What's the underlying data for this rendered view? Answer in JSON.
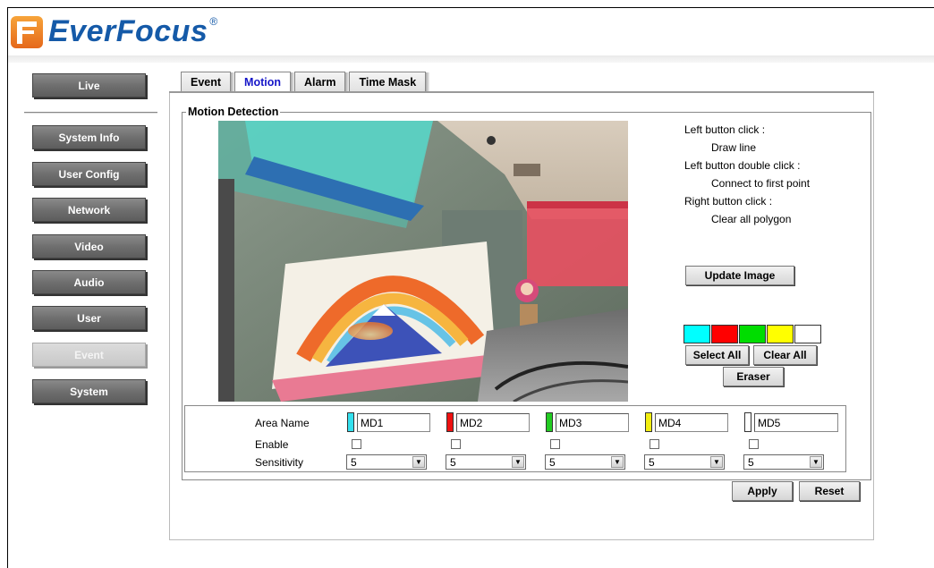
{
  "brand": {
    "name": "EverFocus",
    "reg": "®"
  },
  "sidebar": {
    "live": "Live",
    "items": [
      "System Info",
      "User Config",
      "Network",
      "Video",
      "Audio",
      "User",
      "Event",
      "System"
    ],
    "active": "Event"
  },
  "tabs": [
    {
      "label": "Event",
      "active": false
    },
    {
      "label": "Motion",
      "active": true
    },
    {
      "label": "Alarm",
      "active": false
    },
    {
      "label": "Time Mask",
      "active": false
    }
  ],
  "motion": {
    "legend": "Motion Detection",
    "instructions": {
      "left_click": "Left button click :",
      "left_click_desc": "Draw line",
      "double_click": "Left button double click :",
      "double_click_desc": "Connect to first point",
      "right_click": "Right button click :",
      "right_click_desc": "Clear all polygon"
    },
    "update_image": "Update Image",
    "swatches": [
      "#00ffff",
      "#ff0000",
      "#00dd00",
      "#ffff00",
      "#ffffff"
    ],
    "select_all": "Select All",
    "clear_all": "Clear All",
    "eraser": "Eraser"
  },
  "areas": {
    "labels": {
      "name": "Area Name",
      "enable": "Enable",
      "sensitivity": "Sensitivity"
    },
    "items": [
      {
        "name": "MD1",
        "color": "#33e0ee",
        "enabled": false,
        "sensitivity": "5"
      },
      {
        "name": "MD2",
        "color": "#ee1111",
        "enabled": false,
        "sensitivity": "5"
      },
      {
        "name": "MD3",
        "color": "#22cc22",
        "enabled": false,
        "sensitivity": "5"
      },
      {
        "name": "MD4",
        "color": "#f2ee11",
        "enabled": false,
        "sensitivity": "5"
      },
      {
        "name": "MD5",
        "color": "#ffffff",
        "enabled": false,
        "sensitivity": "5"
      }
    ]
  },
  "actions": {
    "apply": "Apply",
    "reset": "Reset"
  }
}
